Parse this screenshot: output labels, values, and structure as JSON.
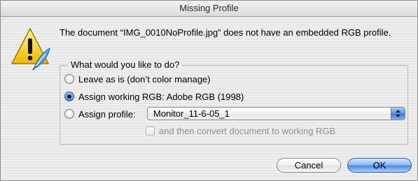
{
  "window": {
    "title": "Missing Profile"
  },
  "message": "The document “IMG_0010NoProfile.jpg” does not have an embedded RGB profile.",
  "options": {
    "group_label": "What would you like to do?",
    "leave_as_is": "Leave as is (don’t color manage)",
    "assign_working": "Assign working RGB:  Adobe RGB (1998)",
    "assign_profile": "Assign profile:",
    "selected": "assign_working"
  },
  "profile_select": {
    "value": "Monitor_11-6-05_1"
  },
  "convert_checkbox": {
    "label": "and then convert document to working RGB",
    "checked": false,
    "enabled": false
  },
  "buttons": {
    "cancel": "Cancel",
    "ok": "OK"
  },
  "icons": {
    "alert": "warning-triangle-icon",
    "app": "feather-icon",
    "select_arrows": "up-down-arrows-icon"
  },
  "colors": {
    "accent": "#4c8be3",
    "warning": "#f5c400"
  }
}
